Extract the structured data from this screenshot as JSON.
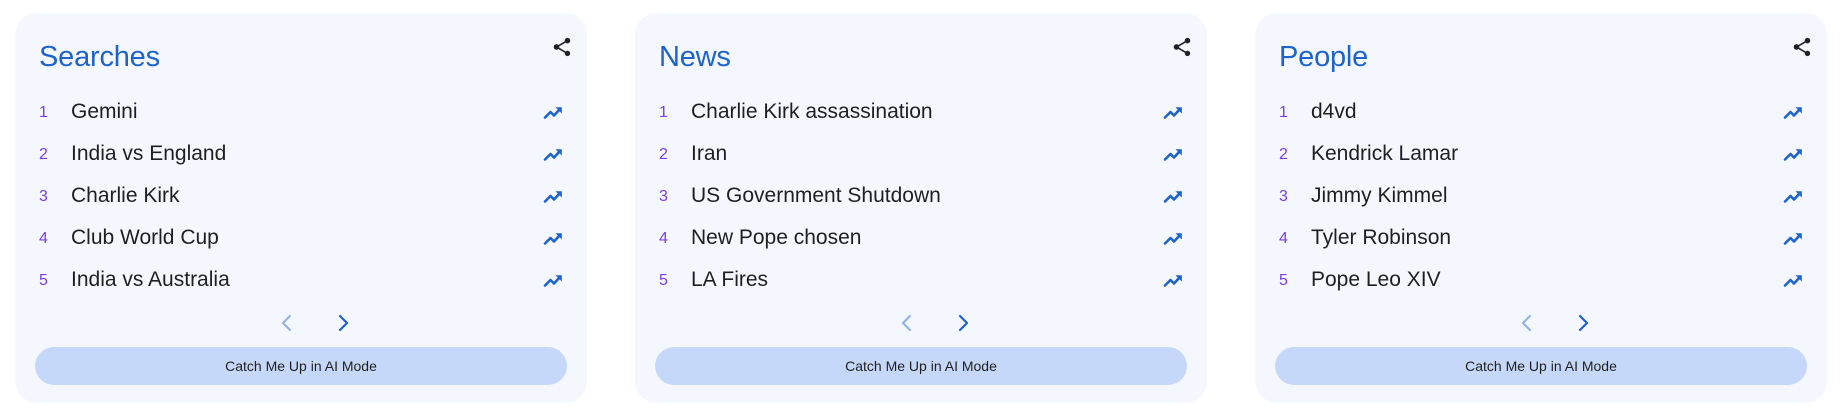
{
  "colors": {
    "card_background": "#f4f7fd",
    "title": "#1d63cc",
    "rank": "#7b3fe4",
    "trend_icon": "#1d63cc",
    "pager_next": "#1d63cc",
    "pager_prev_disabled": "#8fb0e6",
    "cta_background": "#c6d8fa"
  },
  "cards": [
    {
      "title": "Searches",
      "share_icon": "share-icon",
      "items": [
        {
          "rank": "1",
          "label": "Gemini"
        },
        {
          "rank": "2",
          "label": "India vs England"
        },
        {
          "rank": "3",
          "label": "Charlie Kirk"
        },
        {
          "rank": "4",
          "label": "Club World Cup"
        },
        {
          "rank": "5",
          "label": "India vs Australia"
        }
      ],
      "trend_icon": "trending-up-icon",
      "pager": {
        "prev_icon": "chevron-left-icon",
        "prev_disabled": true,
        "next_icon": "chevron-right-icon"
      },
      "cta_label": "Catch Me Up in AI Mode"
    },
    {
      "title": "News",
      "share_icon": "share-icon",
      "items": [
        {
          "rank": "1",
          "label": "Charlie Kirk assassination"
        },
        {
          "rank": "2",
          "label": "Iran"
        },
        {
          "rank": "3",
          "label": "US Government Shutdown"
        },
        {
          "rank": "4",
          "label": "New Pope chosen"
        },
        {
          "rank": "5",
          "label": "LA Fires"
        }
      ],
      "trend_icon": "trending-up-icon",
      "pager": {
        "prev_icon": "chevron-left-icon",
        "prev_disabled": true,
        "next_icon": "chevron-right-icon"
      },
      "cta_label": "Catch Me Up in AI Mode"
    },
    {
      "title": "People",
      "share_icon": "share-icon",
      "items": [
        {
          "rank": "1",
          "label": "d4vd"
        },
        {
          "rank": "2",
          "label": "Kendrick Lamar"
        },
        {
          "rank": "3",
          "label": "Jimmy Kimmel"
        },
        {
          "rank": "4",
          "label": "Tyler Robinson"
        },
        {
          "rank": "5",
          "label": "Pope Leo XIV"
        }
      ],
      "trend_icon": "trending-up-icon",
      "pager": {
        "prev_icon": "chevron-left-icon",
        "prev_disabled": true,
        "next_icon": "chevron-right-icon"
      },
      "cta_label": "Catch Me Up in AI Mode"
    }
  ]
}
